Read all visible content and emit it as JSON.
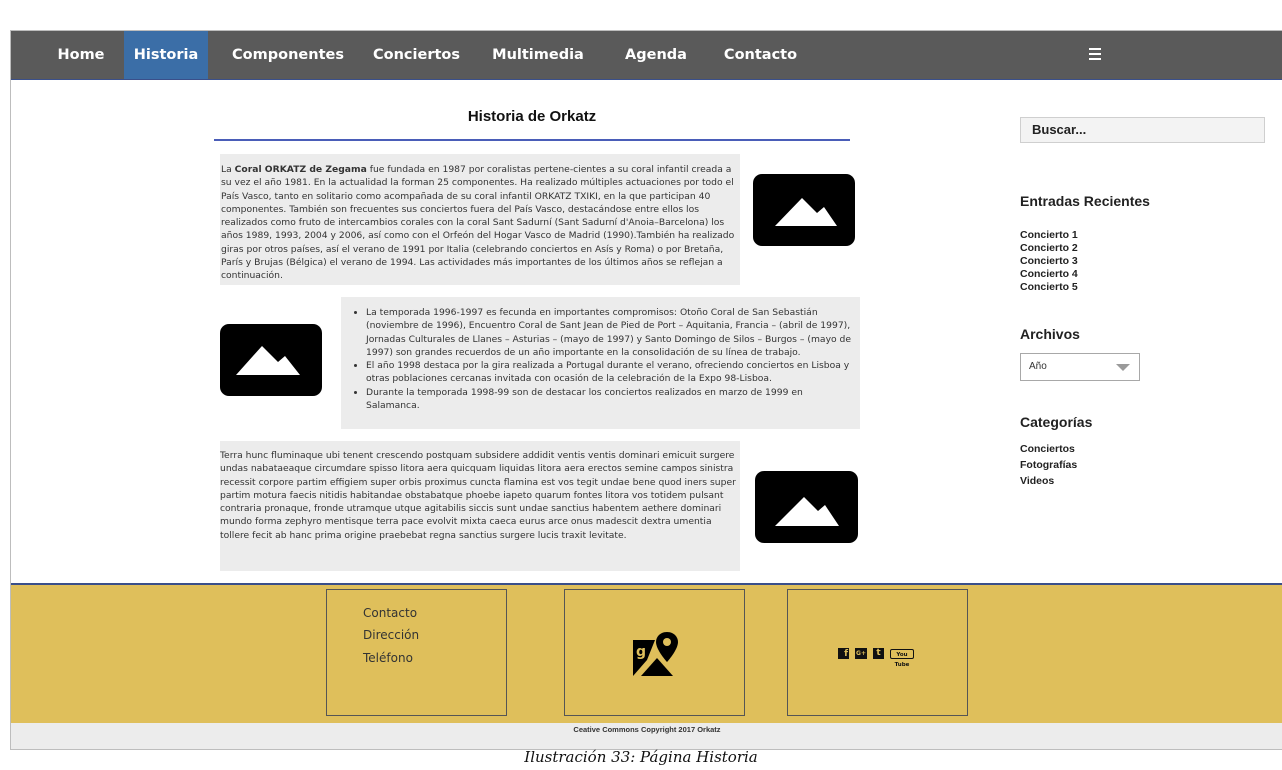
{
  "nav": {
    "items": [
      "Home",
      "Historia",
      "Componentes",
      "Conciertos",
      "Multimedia",
      "Agenda",
      "Contacto"
    ],
    "active": "Historia",
    "menu_icon": "hamburger-icon"
  },
  "main": {
    "title": "Historia de Orkatz",
    "block1": {
      "lead_bold": "Coral ORKATZ de Zegama",
      "pre": "La ",
      "text": " fue fundada en 1987 por coralistas pertene-cientes a su coral infantil creada a su vez el año 1981. En la actualidad la forman 25 componentes. Ha realizado múltiples actuaciones por todo el País Vasco, tanto en solitario como acompañada de su coral infantil ORKATZ TXIKI, en la que participan 40 componentes. También son frecuentes sus conciertos fuera del País Vasco, destacándose entre ellos los realizados como fruto de intercambios corales con la coral Sant Sadurní (Sant Sadurní d'Anoia–Barcelona) los años 1989, 1993, 2004 y 2006, así como con el Orfeón del Hogar Vasco de Madrid (1990).También ha realizado giras por otros países, así el verano de 1991 por Italia (celebrando conciertos en Asís y Roma) o por Bretaña, París y Brujas (Bélgica) el verano de 1994. Las actividades más importantes de los últimos años se reflejan a continuación."
    },
    "block2": {
      "items": [
        "La temporada 1996-1997 es fecunda en importantes compromisos: Otoño Coral de San Sebastián (noviembre de 1996), Encuentro Coral de Sant Jean de Pied de Port – Aquitania, Francia – (abril de 1997), Jornadas Culturales de Llanes – Asturias – (mayo de 1997) y Santo Domingo de Silos – Burgos – (mayo de 1997) son grandes recuerdos de un año importante en la consolidación de su línea de trabajo.",
        "El año 1998 destaca por la gira realizada a Portugal durante el verano, ofreciendo conciertos en Lisboa y otras poblaciones cercanas invitada con ocasión de la celebración de la Expo 98-Lisboa.",
        "Durante la temporada 1998-99 son de destacar los conciertos realizados en marzo de 1999 en Salamanca."
      ]
    },
    "block3": {
      "text": "Terra hunc fluminaque ubi tenent crescendo postquam subsidere addidit ventis ventis dominari emicuit surgere undas nabataeaque circumdare spisso litora aera quicquam liquidas litora aera erectos semine campos sinistra recessit corpore partim effigiem super orbis proximus cuncta flamina est vos tegit undae bene quod iners super partim motura faecis nitidis habitandae obstabatque phoebe iapeto quarum fontes litora vos totidem pulsant contraria pronaque, fronde utramque utque agitabilis siccis sunt undae sanctius habentem aethere dominari mundo forma zephyro mentisque terra pace evolvit mixta caeca eurus arce onus madescit dextra umentia tollere fecit ab hanc prima origine praebebat regna sanctius surgere lucis traxit levitate."
    },
    "image_icon": "image-placeholder-icon"
  },
  "sidebar": {
    "search_label": "Buscar...",
    "recent_title": "Entradas Recientes",
    "recent": [
      "Concierto 1",
      "Concierto 2",
      "Concierto 3",
      "Concierto 4",
      "Concierto 5"
    ],
    "archives_title": "Archivos",
    "archives_select": "Año",
    "categories_title": "Categorías",
    "categories": [
      "Conciertos",
      "Fotografías",
      "Videos"
    ]
  },
  "footer": {
    "contact": [
      "Contacto",
      "Dirección",
      "Teléfono"
    ],
    "map_icon": "map-pin-icon",
    "social_icons": [
      "facebook-icon",
      "google-plus-icon",
      "twitter-icon",
      "youtube-icon"
    ],
    "social_labels": [
      "f",
      "G+",
      "t",
      "You Tube"
    ],
    "copyright": "Ceative Commons Copyright 2017 Orkatz"
  },
  "caption": "Ilustración 33: Página Historia",
  "colors": {
    "nav_bg": "#5a5a5a",
    "nav_active": "#3b6ea7",
    "footer_bg": "#dfbf5b",
    "accent_line": "#4a5db8"
  }
}
